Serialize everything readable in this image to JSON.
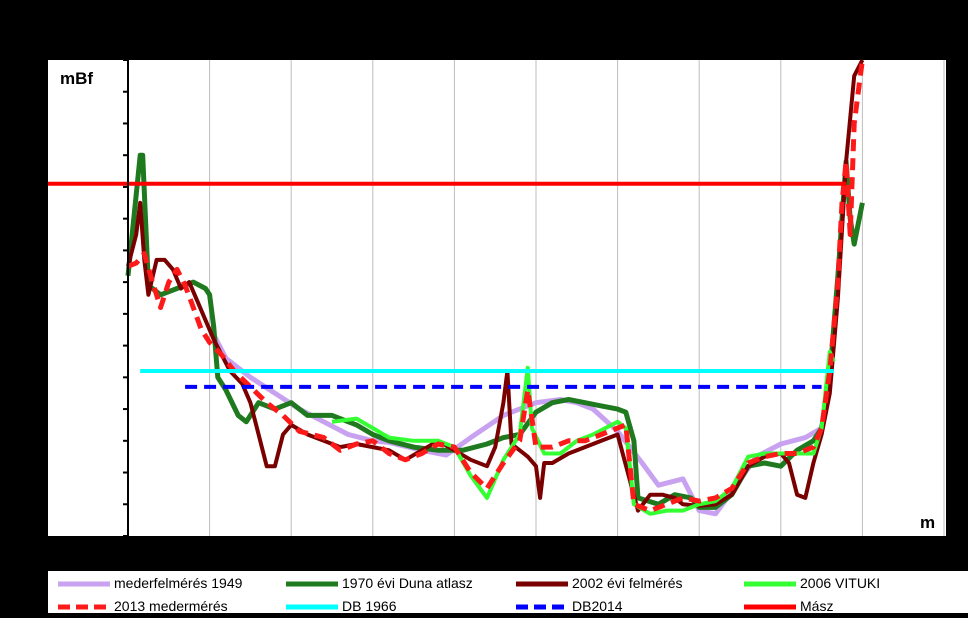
{
  "chart_data": {
    "type": "line",
    "title": "",
    "ylabel": "mBf",
    "xlabel": "m",
    "xlim": [
      0,
      1000
    ],
    "ylim": [
      0,
      15
    ],
    "grid": "vertical",
    "legend_position": "bottom",
    "series": [
      {
        "name": "mederfelmérés 1949",
        "color": "#c8a2f0",
        "style": "solid",
        "width": 5,
        "points": [
          [
            100,
            6.6
          ],
          [
            120,
            5.6
          ],
          [
            150,
            5.0
          ],
          [
            180,
            4.5
          ],
          [
            210,
            4.0
          ],
          [
            240,
            3.6
          ],
          [
            270,
            3.2
          ],
          [
            300,
            3.0
          ],
          [
            320,
            2.95
          ],
          [
            360,
            2.7
          ],
          [
            390,
            2.55
          ],
          [
            420,
            3.1
          ],
          [
            460,
            3.8
          ],
          [
            500,
            4.2
          ],
          [
            530,
            4.3
          ],
          [
            550,
            4.2
          ],
          [
            570,
            4.0
          ],
          [
            600,
            3.3
          ],
          [
            630,
            2.3
          ],
          [
            650,
            1.6
          ],
          [
            680,
            1.8
          ],
          [
            700,
            0.8
          ],
          [
            720,
            0.7
          ],
          [
            740,
            1.4
          ],
          [
            770,
            2.5
          ],
          [
            800,
            2.9
          ],
          [
            830,
            3.1
          ],
          [
            850,
            3.4
          ]
        ]
      },
      {
        "name": "1970 évi Duna atlasz",
        "color": "#1f7a1f",
        "style": "solid",
        "width": 5,
        "points": [
          [
            0,
            8.2
          ],
          [
            15,
            12.0
          ],
          [
            18,
            12.0
          ],
          [
            25,
            7.9
          ],
          [
            40,
            7.6
          ],
          [
            60,
            7.8
          ],
          [
            80,
            8.0
          ],
          [
            95,
            7.8
          ],
          [
            100,
            7.6
          ],
          [
            105,
            6.6
          ],
          [
            110,
            5.0
          ],
          [
            120,
            4.6
          ],
          [
            135,
            3.8
          ],
          [
            145,
            3.6
          ],
          [
            160,
            4.2
          ],
          [
            180,
            4.0
          ],
          [
            200,
            4.2
          ],
          [
            220,
            3.8
          ],
          [
            250,
            3.8
          ],
          [
            280,
            3.5
          ],
          [
            300,
            3.2
          ],
          [
            320,
            3.0
          ],
          [
            350,
            2.8
          ],
          [
            380,
            2.7
          ],
          [
            410,
            2.7
          ],
          [
            440,
            2.9
          ],
          [
            460,
            3.1
          ],
          [
            480,
            3.2
          ],
          [
            500,
            3.9
          ],
          [
            520,
            4.2
          ],
          [
            540,
            4.3
          ],
          [
            560,
            4.2
          ],
          [
            580,
            4.1
          ],
          [
            600,
            4.0
          ],
          [
            610,
            3.9
          ],
          [
            620,
            3.0
          ],
          [
            625,
            1.2
          ],
          [
            650,
            1.0
          ],
          [
            670,
            1.3
          ],
          [
            690,
            1.2
          ],
          [
            700,
            0.9
          ],
          [
            720,
            0.9
          ],
          [
            740,
            1.3
          ],
          [
            760,
            2.2
          ],
          [
            780,
            2.3
          ],
          [
            800,
            2.2
          ],
          [
            820,
            2.7
          ],
          [
            840,
            3.0
          ],
          [
            850,
            3.4
          ],
          [
            860,
            5.0
          ],
          [
            870,
            8.2
          ],
          [
            880,
            11.8
          ],
          [
            885,
            10.0
          ],
          [
            890,
            9.2
          ],
          [
            900,
            10.5
          ]
        ]
      },
      {
        "name": "2002 évi felmérés",
        "color": "#7a0000",
        "style": "solid",
        "width": 4,
        "points": [
          [
            0,
            8.5
          ],
          [
            10,
            9.5
          ],
          [
            15,
            10.5
          ],
          [
            20,
            8.7
          ],
          [
            25,
            7.6
          ],
          [
            35,
            8.7
          ],
          [
            45,
            8.7
          ],
          [
            55,
            8.4
          ],
          [
            65,
            7.8
          ],
          [
            75,
            8.0
          ],
          [
            85,
            7.4
          ],
          [
            95,
            6.8
          ],
          [
            105,
            6.2
          ],
          [
            115,
            5.7
          ],
          [
            125,
            5.2
          ],
          [
            140,
            4.8
          ],
          [
            150,
            4.2
          ],
          [
            160,
            3.2
          ],
          [
            170,
            2.2
          ],
          [
            180,
            2.2
          ],
          [
            190,
            3.2
          ],
          [
            200,
            3.5
          ],
          [
            220,
            3.2
          ],
          [
            240,
            3.0
          ],
          [
            260,
            2.8
          ],
          [
            280,
            2.9
          ],
          [
            300,
            2.8
          ],
          [
            320,
            2.7
          ],
          [
            340,
            2.4
          ],
          [
            360,
            2.7
          ],
          [
            380,
            3.0
          ],
          [
            400,
            2.7
          ],
          [
            420,
            2.4
          ],
          [
            440,
            2.2
          ],
          [
            450,
            2.8
          ],
          [
            460,
            4.2
          ],
          [
            465,
            5.2
          ],
          [
            470,
            2.9
          ],
          [
            480,
            2.7
          ],
          [
            490,
            2.5
          ],
          [
            500,
            2.2
          ],
          [
            505,
            1.2
          ],
          [
            510,
            2.3
          ],
          [
            520,
            2.3
          ],
          [
            540,
            2.6
          ],
          [
            560,
            2.8
          ],
          [
            580,
            3.0
          ],
          [
            600,
            3.2
          ],
          [
            625,
            0.8
          ],
          [
            640,
            1.3
          ],
          [
            655,
            1.3
          ],
          [
            670,
            1.2
          ],
          [
            680,
            1.0
          ],
          [
            700,
            0.95
          ],
          [
            720,
            1.0
          ],
          [
            740,
            1.3
          ],
          [
            760,
            2.2
          ],
          [
            780,
            2.5
          ],
          [
            800,
            2.6
          ],
          [
            810,
            2.3
          ],
          [
            820,
            1.3
          ],
          [
            830,
            1.2
          ],
          [
            840,
            2.3
          ],
          [
            850,
            3.2
          ],
          [
            860,
            4.5
          ],
          [
            870,
            7.5
          ],
          [
            880,
            11.8
          ],
          [
            890,
            14.5
          ],
          [
            900,
            15.3
          ]
        ]
      },
      {
        "name": "2006 VITUKI",
        "color": "#33ff33",
        "style": "solid",
        "width": 4,
        "points": [
          [
            250,
            3.6
          ],
          [
            280,
            3.7
          ],
          [
            300,
            3.4
          ],
          [
            320,
            3.1
          ],
          [
            350,
            3.0
          ],
          [
            380,
            3.0
          ],
          [
            400,
            2.8
          ],
          [
            420,
            1.9
          ],
          [
            440,
            1.2
          ],
          [
            460,
            2.4
          ],
          [
            480,
            3.2
          ],
          [
            490,
            5.3
          ],
          [
            495,
            3.4
          ],
          [
            510,
            2.6
          ],
          [
            530,
            2.6
          ],
          [
            550,
            3.0
          ],
          [
            570,
            3.2
          ],
          [
            600,
            3.6
          ],
          [
            610,
            3.4
          ],
          [
            620,
            1.0
          ],
          [
            640,
            0.7
          ],
          [
            660,
            0.8
          ],
          [
            680,
            0.8
          ],
          [
            700,
            1.0
          ],
          [
            720,
            1.1
          ],
          [
            740,
            1.5
          ],
          [
            760,
            2.5
          ],
          [
            780,
            2.6
          ],
          [
            800,
            2.6
          ],
          [
            820,
            2.6
          ],
          [
            840,
            2.6
          ],
          [
            850,
            3.4
          ],
          [
            860,
            5.8
          ],
          [
            865,
            5.5
          ]
        ]
      },
      {
        "name": "2013 medermérés",
        "color": "#ff1a1a",
        "style": "dashed",
        "width": 5,
        "points": [
          [
            0,
            8.5
          ],
          [
            10,
            8.6
          ],
          [
            20,
            8.9
          ],
          [
            30,
            8.0
          ],
          [
            40,
            7.2
          ],
          [
            50,
            8.0
          ],
          [
            60,
            8.4
          ],
          [
            70,
            7.9
          ],
          [
            80,
            7.2
          ],
          [
            90,
            6.5
          ],
          [
            100,
            6.1
          ],
          [
            115,
            5.7
          ],
          [
            130,
            5.2
          ],
          [
            150,
            4.7
          ],
          [
            170,
            4.2
          ],
          [
            190,
            3.8
          ],
          [
            210,
            3.3
          ],
          [
            240,
            3.1
          ],
          [
            260,
            2.7
          ],
          [
            280,
            2.9
          ],
          [
            300,
            3.0
          ],
          [
            320,
            2.6
          ],
          [
            340,
            2.4
          ],
          [
            360,
            2.6
          ],
          [
            380,
            2.9
          ],
          [
            400,
            2.8
          ],
          [
            420,
            2.0
          ],
          [
            440,
            1.5
          ],
          [
            460,
            2.3
          ],
          [
            480,
            3.0
          ],
          [
            490,
            4.6
          ],
          [
            500,
            2.8
          ],
          [
            520,
            2.8
          ],
          [
            540,
            3.0
          ],
          [
            560,
            3.0
          ],
          [
            580,
            3.2
          ],
          [
            600,
            3.4
          ],
          [
            610,
            3.5
          ],
          [
            620,
            1.0
          ],
          [
            640,
            0.8
          ],
          [
            660,
            1.0
          ],
          [
            680,
            1.2
          ],
          [
            700,
            1.1
          ],
          [
            720,
            1.2
          ],
          [
            740,
            1.5
          ],
          [
            760,
            2.3
          ],
          [
            780,
            2.5
          ],
          [
            800,
            2.6
          ],
          [
            820,
            2.6
          ],
          [
            840,
            2.8
          ],
          [
            850,
            3.4
          ],
          [
            860,
            5.2
          ],
          [
            870,
            8.0
          ],
          [
            875,
            10.5
          ],
          [
            880,
            11.8
          ],
          [
            885,
            9.5
          ],
          [
            890,
            13.0
          ],
          [
            900,
            15.2
          ]
        ]
      },
      {
        "name": "DB 1966",
        "color": "#00ffff",
        "style": "solid",
        "width": 4,
        "points": [
          [
            15,
            5.2
          ],
          [
            865,
            5.2
          ]
        ]
      },
      {
        "name": "DB2014",
        "color": "#0000ff",
        "style": "dashed",
        "width": 4,
        "points": [
          [
            70,
            4.7
          ],
          [
            850,
            4.7
          ]
        ]
      },
      {
        "name": "Mász",
        "color": "#ff0000",
        "style": "solid",
        "width": 4,
        "points": [
          [
            -100,
            11.1
          ],
          [
            880,
            11.1
          ]
        ]
      }
    ]
  },
  "legend": {
    "items": [
      {
        "label": "mederfelmérés 1949",
        "color": "#c8a2f0",
        "style": "solid"
      },
      {
        "label": "1970 évi Duna atlasz",
        "color": "#1f7a1f",
        "style": "solid"
      },
      {
        "label": "2002 évi felmérés",
        "color": "#7a0000",
        "style": "solid"
      },
      {
        "label": "2006 VITUKI",
        "color": "#33ff33",
        "style": "solid"
      },
      {
        "label": "2013 medermérés",
        "color": "#ff1a1a",
        "style": "dashed"
      },
      {
        "label": "DB 1966",
        "color": "#00ffff",
        "style": "solid"
      },
      {
        "label": "DB2014",
        "color": "#0000ff",
        "style": "dashed"
      },
      {
        "label": "Mász",
        "color": "#ff0000",
        "style": "solid"
      }
    ]
  }
}
